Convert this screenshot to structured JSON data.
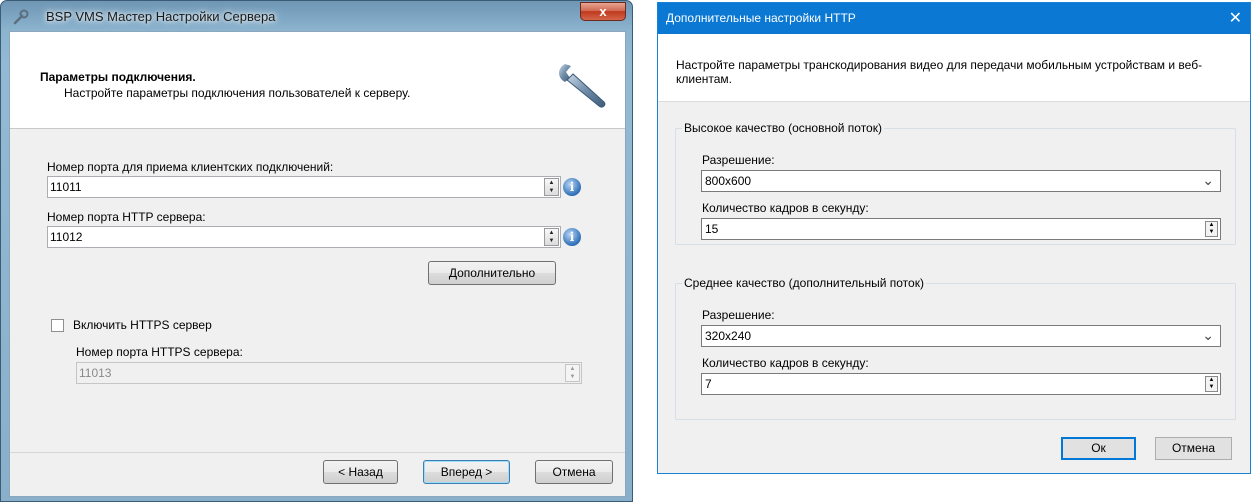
{
  "left_window": {
    "title": "BSP VMS Мастер Настройки Сервера",
    "close_label": "x",
    "header": {
      "title": "Параметры подключения.",
      "subtitle": "Настройте параметры подключения пользователей к серверу."
    },
    "client_port": {
      "label": "Номер порта для приема клиентских подключений:",
      "value": "11011"
    },
    "http_port": {
      "label": "Номер порта HTTP сервера:",
      "value": "11012"
    },
    "advanced_button": "Дополнительно",
    "https": {
      "checkbox_label": "Включить HTTPS сервер",
      "checked": false,
      "port_label": "Номер порта HTTPS сервера:",
      "port_value": "11013"
    },
    "buttons": {
      "back": "< Назад",
      "next": "Вперед >",
      "cancel": "Отмена"
    }
  },
  "right_window": {
    "title": "Дополнительные настройки HTTP",
    "close_label": "✕",
    "description": "Настройте параметры транскодирования видео для передачи мобильным устройствам и веб-клиентам.",
    "high_quality": {
      "legend": "Высокое качество (основной поток)",
      "resolution_label": "Разрешение:",
      "resolution_value": "800x600",
      "fps_label": "Количество кадров в секунду:",
      "fps_value": "15"
    },
    "medium_quality": {
      "legend": "Среднее качество (дополнительный поток)",
      "resolution_label": "Разрешение:",
      "resolution_value": "320x240",
      "fps_label": "Количество кадров в секунду:",
      "fps_value": "7"
    },
    "buttons": {
      "ok": "Ок",
      "cancel": "Отмена"
    }
  },
  "colors": {
    "win10_accent": "#0b78d4",
    "aero_frame": "#8cb4cf"
  }
}
